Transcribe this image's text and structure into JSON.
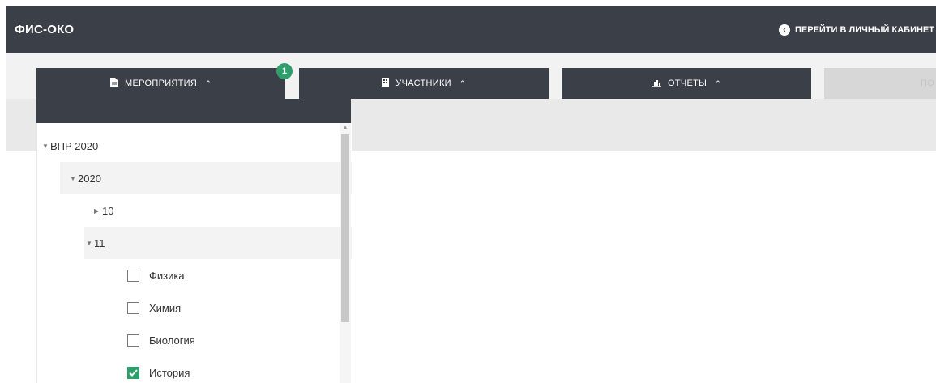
{
  "header": {
    "title": "ФИС-ОКО",
    "cabinet_link": "ПЕРЕЙТИ В ЛИЧНЫЙ КАБИНЕТ",
    "cabinet_icon": "chevron-left-circle-icon"
  },
  "tabs": [
    {
      "label": "МЕРОПРИЯТИЯ",
      "icon": "document-icon",
      "badge": "1"
    },
    {
      "label": "УЧАСТНИКИ",
      "icon": "building-icon"
    },
    {
      "label": "ОТЧЕТЫ",
      "icon": "bar-chart-icon"
    },
    {
      "label": "ПО"
    }
  ],
  "tree": {
    "root": "ВПР 2020",
    "year": "2020",
    "grade10": "10",
    "grade11": "11",
    "subjects": [
      {
        "label": "Физика",
        "checked": false
      },
      {
        "label": "Химия",
        "checked": false
      },
      {
        "label": "Биология",
        "checked": false
      },
      {
        "label": "История",
        "checked": true
      }
    ]
  },
  "colors": {
    "dark": "#3b3f48",
    "accent": "#2e9e6b"
  }
}
